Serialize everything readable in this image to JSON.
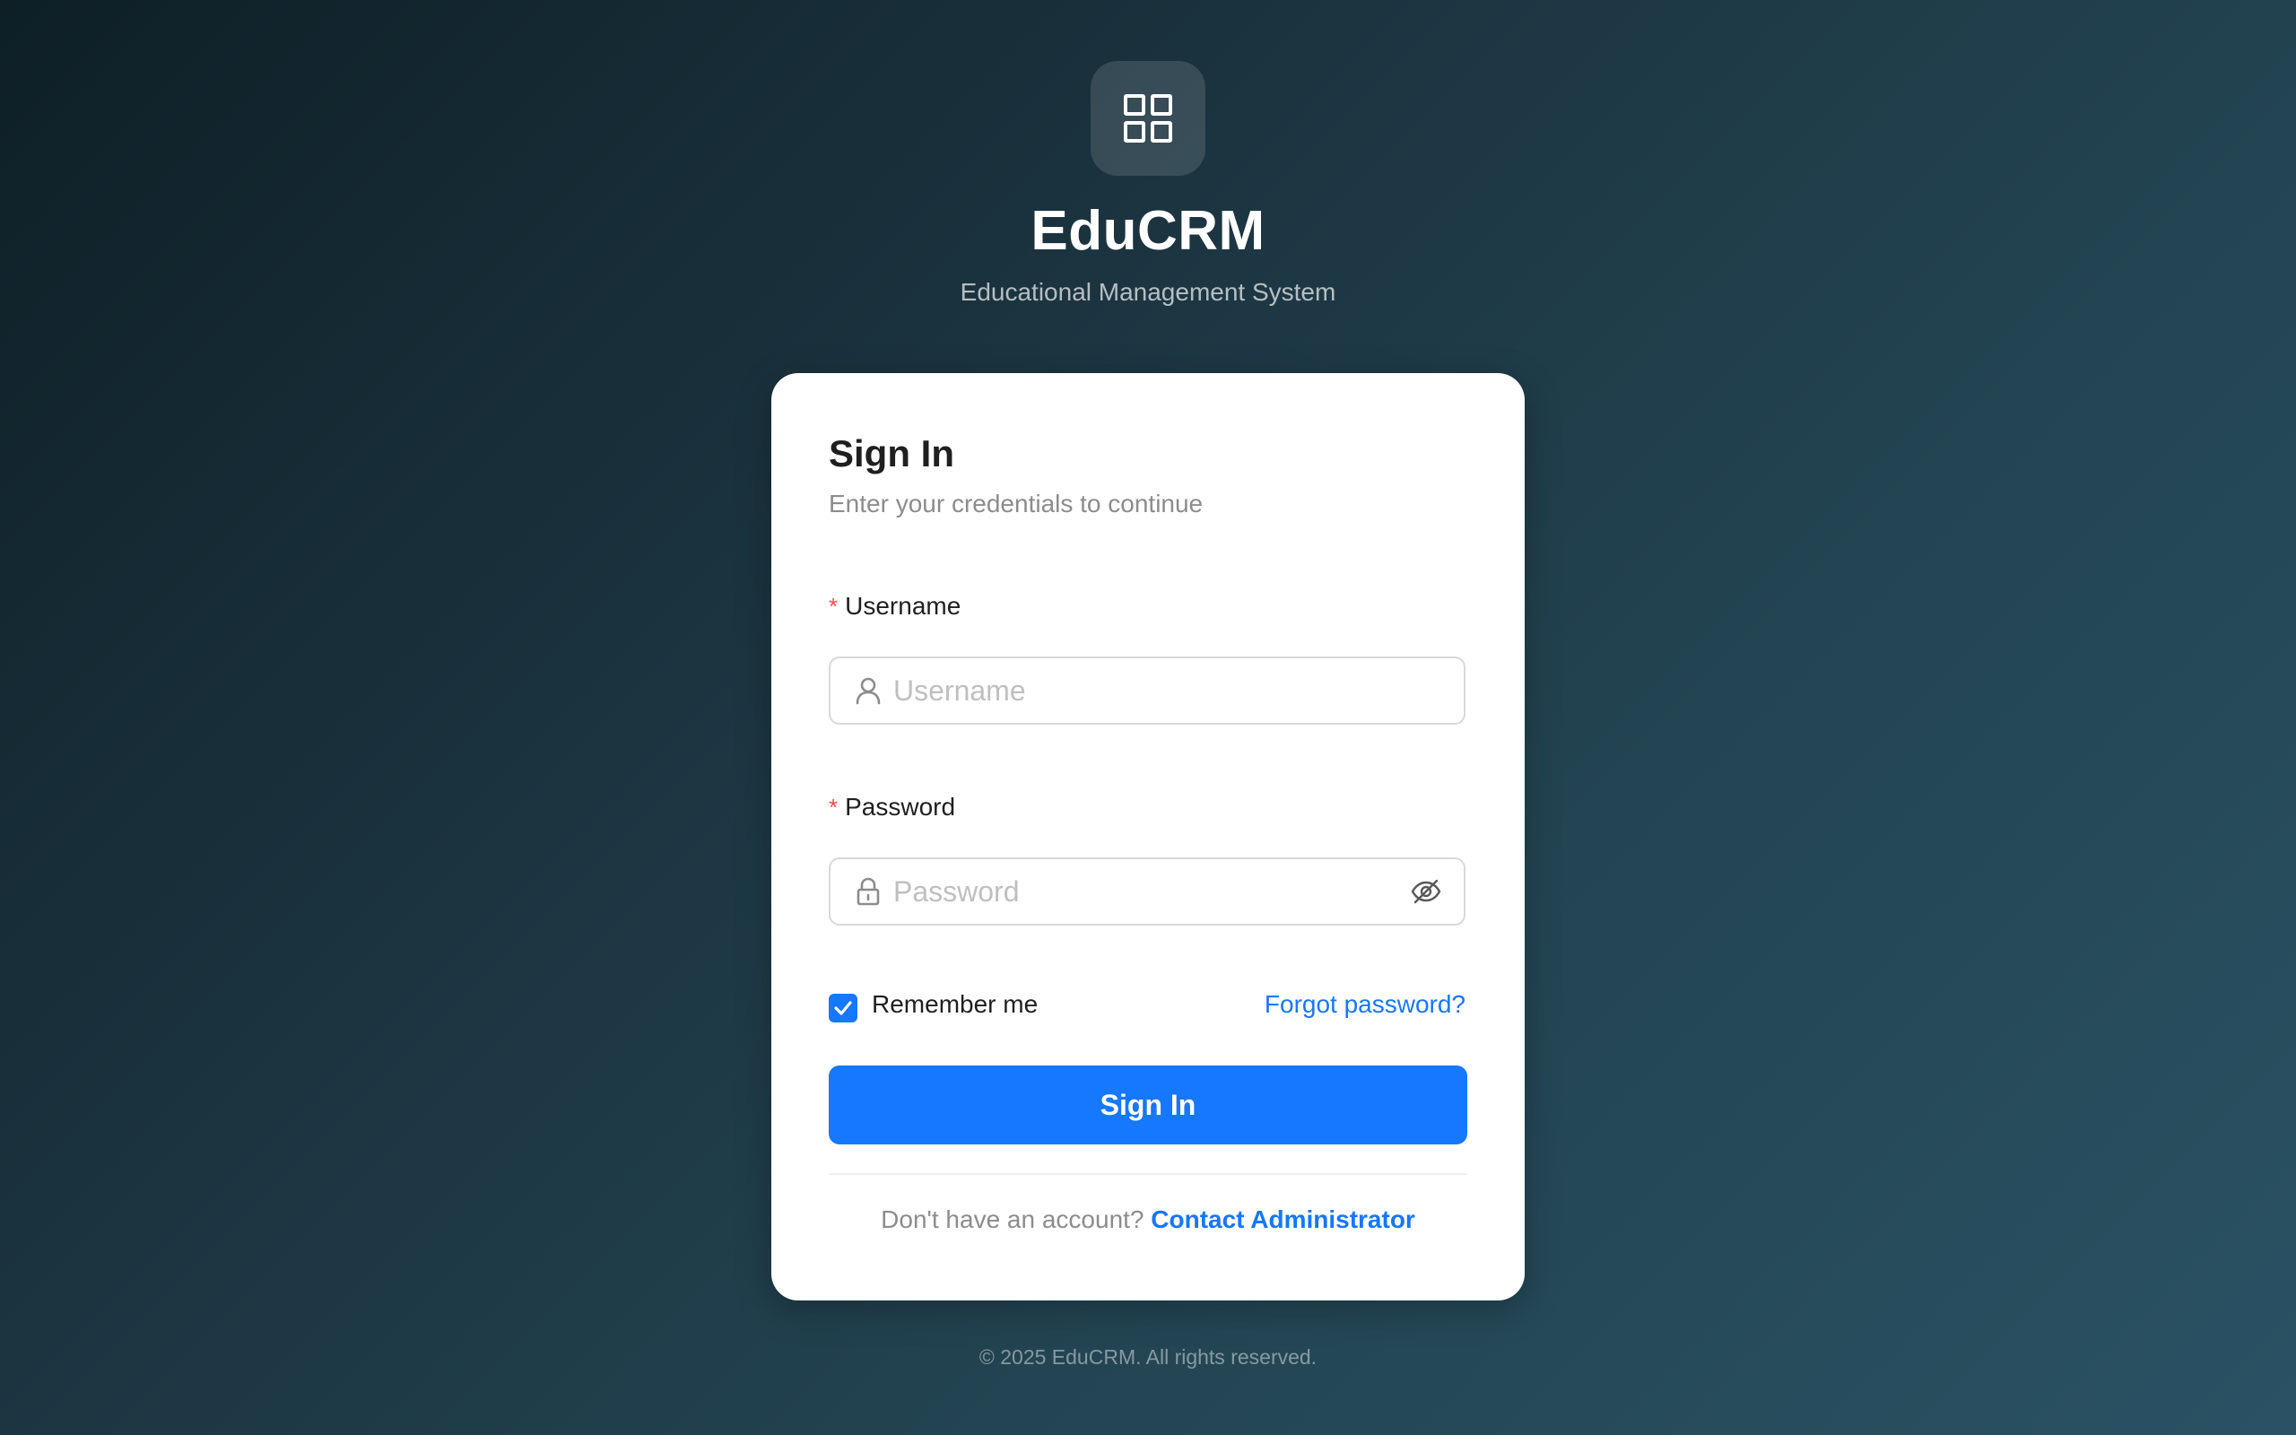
{
  "brand": {
    "logo_icon": "grid-apps-icon",
    "title": "EduCRM",
    "subtitle": "Educational Management System"
  },
  "login": {
    "title": "Sign In",
    "subtitle": "Enter your credentials to continue",
    "username": {
      "label": "Username",
      "required_mark": "*",
      "placeholder": "Username",
      "value": "",
      "icon": "user-icon"
    },
    "password": {
      "label": "Password",
      "required_mark": "*",
      "placeholder": "Password",
      "value": "",
      "icon": "lock-icon",
      "toggle_icon": "eye-invisible-icon"
    },
    "remember_me": {
      "label": "Remember me",
      "checked": true
    },
    "forgot_password": "Forgot password?",
    "submit_label": "Sign In",
    "footer_prompt": "Don't have an account?",
    "footer_link": "Contact Administrator"
  },
  "copyright": "© 2025 EduCRM. All rights reserved.",
  "colors": {
    "primary": "#1677ff",
    "required": "#ff4d4f",
    "background_dark": "#0e1f26",
    "background_light": "#2a5264"
  }
}
